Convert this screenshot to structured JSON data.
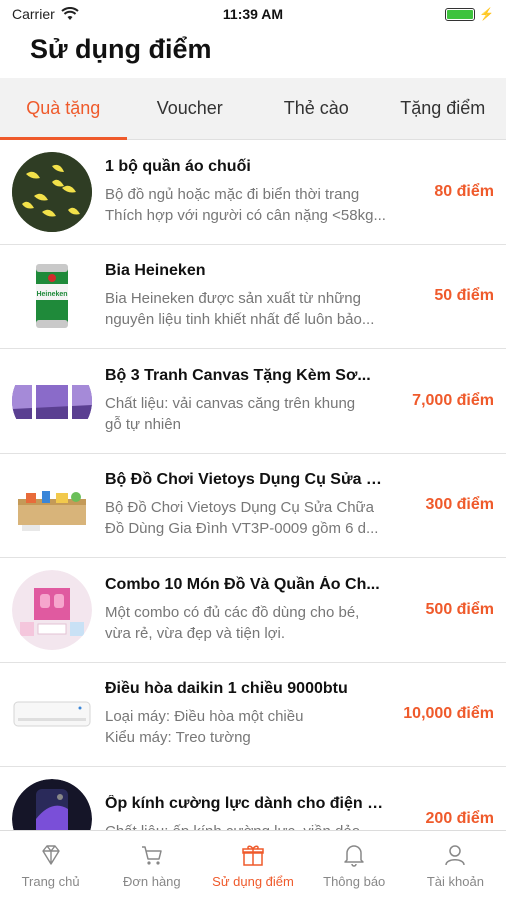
{
  "status_bar": {
    "carrier": "Carrier",
    "time": "11:39 AM",
    "battery_level": 1.0
  },
  "header": {
    "title": "Sử dụng điểm"
  },
  "tabs": [
    {
      "label": "Quà tặng",
      "active": true
    },
    {
      "label": "Voucher",
      "active": false
    },
    {
      "label": "Thẻ cào",
      "active": false
    },
    {
      "label": "Tặng điểm",
      "active": false
    }
  ],
  "items": [
    {
      "title": "1 bộ quần áo chuối",
      "desc1": "Bộ đồ ngủ hoặc mặc đi biển thời trang",
      "desc2": "Thích hợp với người có cân nặng <58kg...",
      "points": "80 điểm",
      "icon": "banana-clothes-image"
    },
    {
      "title": "Bia Heineken",
      "desc1": "Bia Heineken được sản xuất từ những",
      "desc2": "nguyên liệu tinh khiết nhất để luôn bảo...",
      "points": "50 điểm",
      "icon": "beer-can-image"
    },
    {
      "title": "Bộ 3 Tranh Canvas Tặng Kèm Sơ...",
      "desc1": "Chất liệu: vải canvas căng trên khung",
      "desc2": "gỗ tự nhiên",
      "points": "7,000 điểm",
      "icon": "canvas-painting-image"
    },
    {
      "title": "Bộ Đồ Chơi Vietoys Dụng Cụ Sửa C...",
      "desc1": "Bộ Đồ Chơi Vietoys Dụng Cụ Sửa Chữa",
      "desc2": "Đồ Dùng Gia Đình VT3P-0009 gồm 6 d...",
      "points": "300 điểm",
      "icon": "toy-tools-image"
    },
    {
      "title": "Combo 10 Món Đồ Và Quần Áo Ch...",
      "desc1": "Một combo có đủ các đồ dùng cho bé,",
      "desc2": "vừa rẻ, vừa đẹp và tiện lợi.",
      "points": "500 điểm",
      "icon": "baby-combo-image"
    },
    {
      "title": "Điều hòa daikin 1 chiều 9000btu",
      "desc1": "Loại máy: Điều hòa một chiều",
      "desc2": "Kiểu máy: Treo tường",
      "points": "10,000 điểm",
      "icon": "air-conditioner-image"
    },
    {
      "title": "Ốp kính cường lực dành cho điện t...",
      "desc1": "Chất liệu: ốp kính cường lực, viền dẻo",
      "desc2": "",
      "points": "200 điểm",
      "icon": "phone-case-image"
    }
  ],
  "tabbar": [
    {
      "label": "Trang chủ",
      "icon": "diamond-icon",
      "active": false
    },
    {
      "label": "Đơn hàng",
      "icon": "cart-icon",
      "active": false
    },
    {
      "label": "Sử dụng điểm",
      "icon": "gift-icon",
      "active": true
    },
    {
      "label": "Thông báo",
      "icon": "bell-icon",
      "active": false
    },
    {
      "label": "Tài khoản",
      "icon": "user-icon",
      "active": false
    }
  ],
  "colors": {
    "accent": "#ef5a2b",
    "inactive": "#888888"
  }
}
